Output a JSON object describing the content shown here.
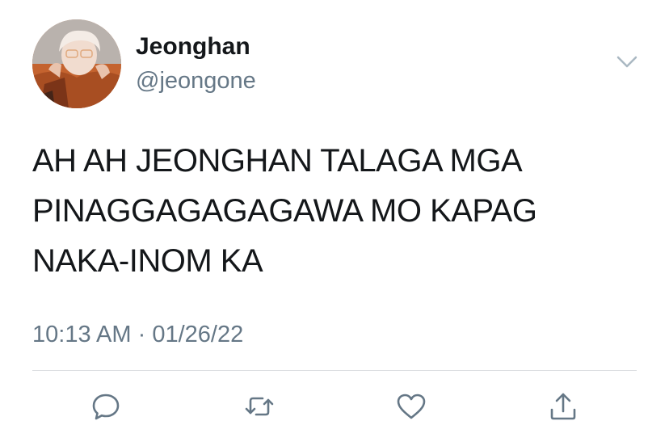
{
  "tweet": {
    "display_name": "Jeonghan",
    "handle": "@jeongone",
    "text": "AH AH JEONGHAN TALAGA MGA\nPINAGGAGAGAGAWA MO KAPAG\nNAKA-INOM KA",
    "time": "10:13 AM",
    "separator": "·",
    "date": "01/26/22"
  },
  "icons": {
    "caret": "chevron-down-icon",
    "reply": "reply-icon",
    "retweet": "retweet-icon",
    "like": "heart-icon",
    "share": "share-icon"
  },
  "colors": {
    "primary_text": "#14171a",
    "secondary_text": "#657786",
    "icon": "#657786",
    "divider": "#dcdfe2"
  }
}
